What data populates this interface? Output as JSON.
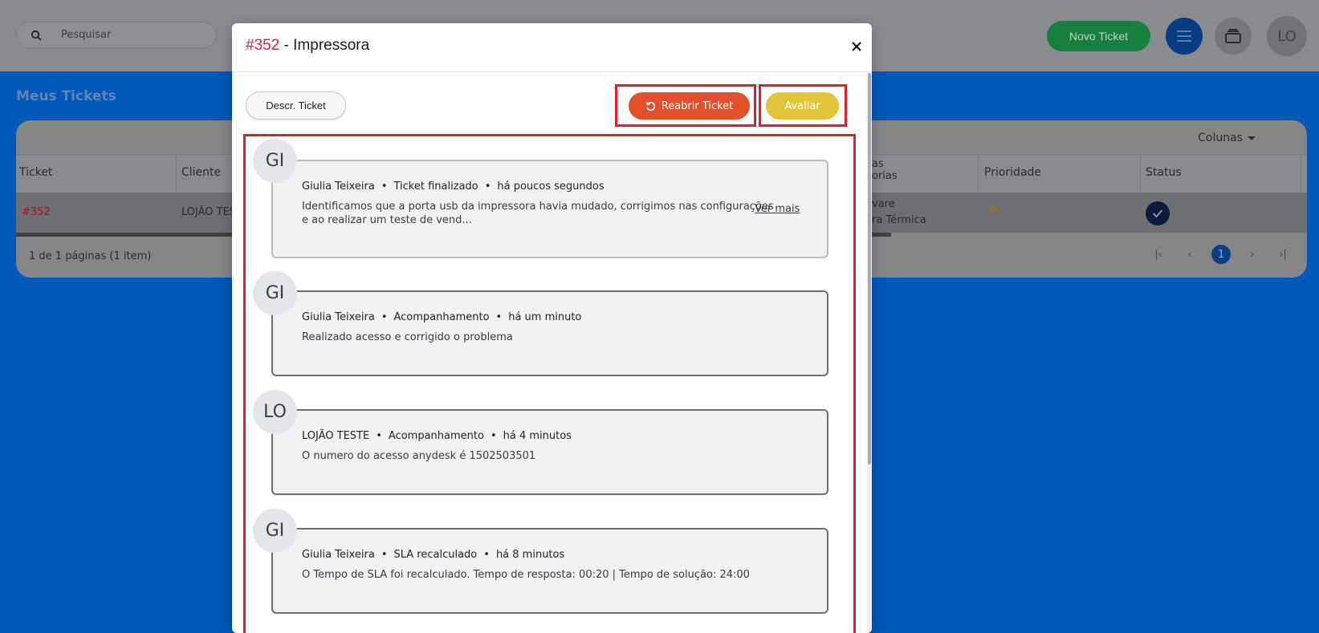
{
  "app": {
    "search_placeholder": "Pesquisar",
    "new_ticket_label": "Novo Ticket",
    "avatar_initials": "LO",
    "page_title": "Meus Tickets"
  },
  "table": {
    "columns_toggle": "Colunas",
    "headers": {
      "ticket": "Ticket",
      "cliente": "Cliente",
      "categorias": "as\norias",
      "prioridade": "Prioridade",
      "status": "Status"
    },
    "row": {
      "ticket": "#352",
      "cliente": "LOJÃO TES",
      "categoria_line1": "vare",
      "categoria_line2": "ra Térmica"
    },
    "footer_info": "1 de 1 páginas (1 item)",
    "current_page": "1"
  },
  "modal": {
    "ticket_number": "#352",
    "title_rest": " - Impressora",
    "descr_button": "Descr. Ticket",
    "reopen_button": "Reabrir Ticket",
    "rate_button": "Avaliar",
    "see_more": "Ver mais",
    "entries": [
      {
        "initials": "GI",
        "author": "Giulia Teixeira",
        "type": "Ticket finalizado",
        "time": "há poucos segundos",
        "text_line1": "Identificamos que a porta usb da impressora havia mudado, corrigimos nas configurações",
        "text_line2": "e ao realizar um teste de vend..."
      },
      {
        "initials": "GI",
        "author": "Giulia Teixeira",
        "type": "Acompanhamento",
        "time": "há um minuto",
        "text_line1": "Realizado acesso e corrigido o problema"
      },
      {
        "initials": "LO",
        "author": "LOJÃO TESTE",
        "type": "Acompanhamento",
        "time": "há 4 minutos",
        "text_line1": "O numero do acesso anydesk é 1502503501"
      },
      {
        "initials": "GI",
        "author": "Giulia Teixeira",
        "type": "SLA recalculado",
        "time": "há 8 minutos",
        "text_line1": "O Tempo de SLA foi recalculado. Tempo de resposta: 00:20 | Tempo de solução: 24:00"
      }
    ]
  },
  "colors": {
    "accent_red": "#e0223b",
    "reopen_orange": "#e0502b",
    "rate_yellow": "#e0c43a",
    "new_ticket_green": "#17803f",
    "background_blue": "#0058b8",
    "highlight_red": "#e11d2b"
  }
}
